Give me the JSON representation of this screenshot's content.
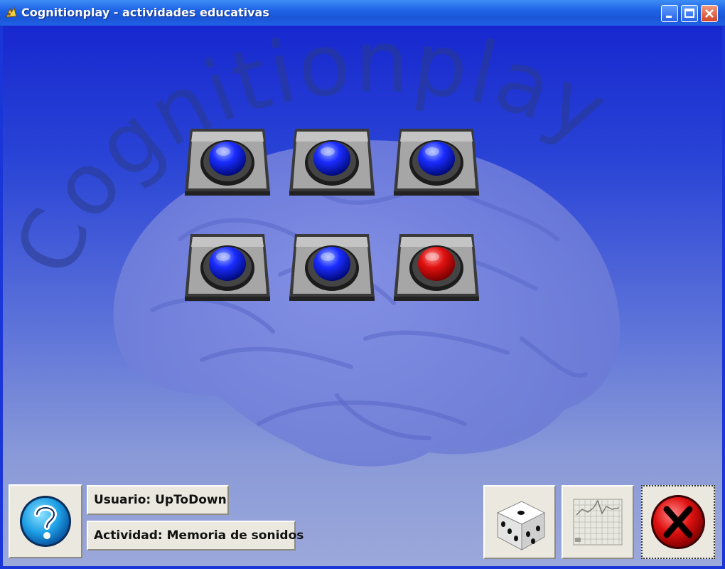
{
  "window": {
    "title": "Cognitionplay - actividades educativas",
    "icons": [
      "app-icon",
      "minimize-icon",
      "maximize-icon",
      "close-icon"
    ]
  },
  "watermark": {
    "text": "Cognitionplay"
  },
  "buttons_grid": {
    "rows": 2,
    "cols": 3,
    "lights": [
      "blue",
      "blue",
      "blue",
      "blue",
      "blue",
      "red"
    ]
  },
  "status": {
    "user_label": "Usuario: UpToDown",
    "activity_label": "Actividad: Memoria de sonidos"
  },
  "toolbar": {
    "icons": [
      "help-icon",
      "dice-icon",
      "statistics-chart-icon",
      "exit-icon"
    ]
  },
  "colors": {
    "titlebar": "#1f63e6",
    "background_top": "#1728cf",
    "background_bottom": "#9ba8da",
    "light_blue": "#1a2cff",
    "light_red": "#e01010",
    "panel": "#ebe8df"
  }
}
